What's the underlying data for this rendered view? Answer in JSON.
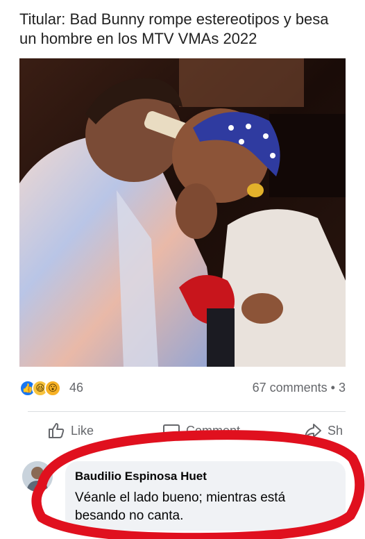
{
  "headline": "Titular: Bad Bunny rompe estereotipos y besa\nun hombre en los MTV VMAs 2022",
  "post": {
    "reaction_icons": [
      "like-icon",
      "haha-icon",
      "wow-icon"
    ],
    "reaction_count": "46",
    "comments_count": "67 comments • 3"
  },
  "actions": {
    "like_label": "Like",
    "comment_label": "Comment",
    "share_label": "Sh"
  },
  "comment": {
    "author": "Baudilio Espinosa Huet",
    "text": "Véanle el lado bueno; mientras está besando no canta."
  },
  "colors": {
    "like_blue": "#1877f2",
    "annotation_red": "#e0101e",
    "muted_text": "#65676b"
  }
}
